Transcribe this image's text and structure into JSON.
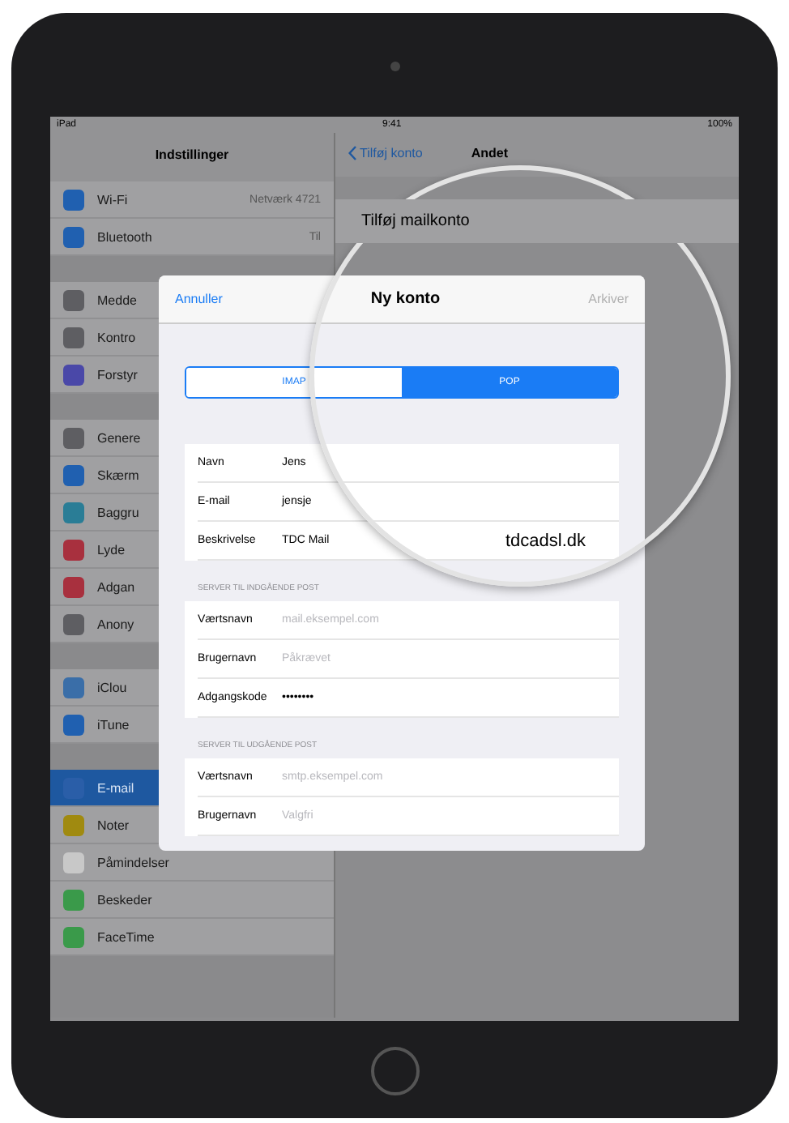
{
  "status_bar": {
    "carrier": "iPad",
    "time": "9:41",
    "battery": "100%"
  },
  "sidebar": {
    "title": "Indstillinger",
    "groups": [
      [
        {
          "label": "Wi-Fi",
          "value": "Netværk 4721",
          "color": "#2060b0",
          "selected": false
        },
        {
          "label": "Bluetooth",
          "value": "Til",
          "color": "#2060b0",
          "selected": false
        }
      ],
      [
        {
          "label": "Medde",
          "color": "#5e5e62",
          "selected": false
        },
        {
          "label": "Kontro",
          "color": "#5e5e62",
          "selected": false
        },
        {
          "label": "Forstyr",
          "color": "#4a48a8",
          "selected": false
        }
      ],
      [
        {
          "label": "Genere",
          "color": "#5e5e62",
          "selected": false
        },
        {
          "label": "Skærm",
          "color": "#2060b0",
          "selected": false
        },
        {
          "label": "Baggru",
          "color": "#2a7d96",
          "selected": false
        },
        {
          "label": "Lyde",
          "color": "#a8303e",
          "selected": false
        },
        {
          "label": "Adgan",
          "color": "#a8303e",
          "selected": false
        },
        {
          "label": "Anony",
          "color": "#5e5e62",
          "selected": false
        }
      ],
      [
        {
          "label": "iClou",
          "color": "#3a6ea8",
          "selected": false
        },
        {
          "label": "iTune",
          "color": "#2060b0",
          "selected": false
        }
      ],
      [
        {
          "label": "E-mail",
          "color": "#2a5ea8",
          "selected": true
        },
        {
          "label": "Noter",
          "color": "#a08a10",
          "selected": false
        },
        {
          "label": "Påmindelser",
          "color": "#c8c8c8",
          "selected": false
        },
        {
          "label": "Beskeder",
          "color": "#3a9a4a",
          "selected": false
        },
        {
          "label": "FaceTime",
          "color": "#3a9a4a",
          "selected": false
        }
      ]
    ]
  },
  "detail": {
    "back": "Tilføj konto",
    "title": "Andet",
    "row": "Tilføj mailkonto"
  },
  "modal": {
    "cancel": "Annuller",
    "title": "Ny konto",
    "save": "Arkiver",
    "save_disabled": true,
    "segments": [
      {
        "label": "IMAP",
        "selected": false
      },
      {
        "label": "POP",
        "selected": true
      }
    ],
    "account": [
      {
        "label": "Navn",
        "value": "Jens"
      },
      {
        "label": "E-mail",
        "value": "jensje"
      },
      {
        "label": "Beskrivelse",
        "value": "TDC Mail"
      }
    ],
    "magnified_text": "tdcadsl.dk",
    "servers": [
      {
        "header": "SERVER TIL INDGÅENDE POST",
        "rows": [
          {
            "label": "Værtsnavn",
            "placeholder": "mail.eksempel.com"
          },
          {
            "label": "Brugernavn",
            "placeholder": "Påkrævet"
          },
          {
            "label": "Adgangskode",
            "value": "••••••••"
          }
        ]
      },
      {
        "header": "SERVER TIL UDGÅENDE POST",
        "rows": [
          {
            "label": "Værtsnavn",
            "placeholder": "smtp.eksempel.com"
          },
          {
            "label": "Brugernavn",
            "placeholder": "Valgfri"
          }
        ]
      }
    ]
  }
}
